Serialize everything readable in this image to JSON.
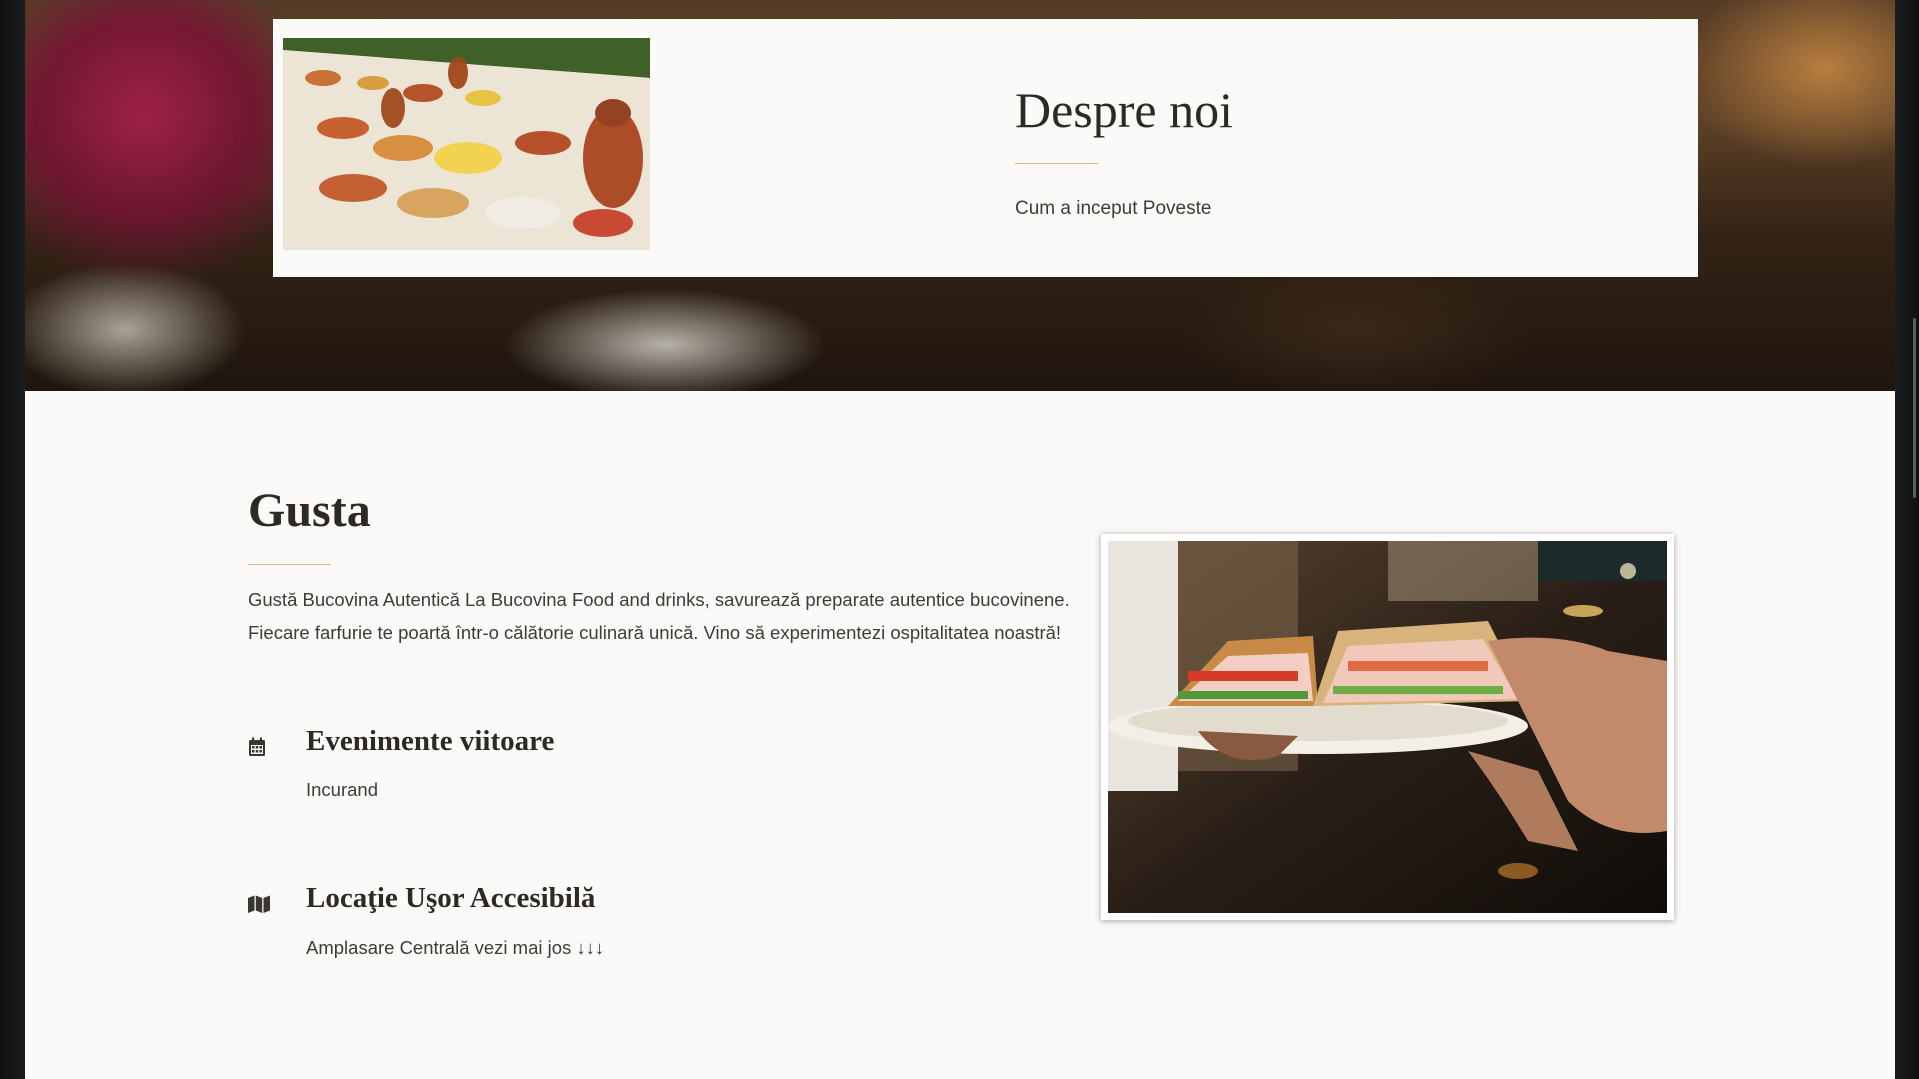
{
  "about": {
    "title": "Despre noi",
    "subtitle": "Cum a inceput Poveste",
    "photo_icon": "food-table-photo"
  },
  "gusta": {
    "title": "Gusta",
    "description": "Gustă Bucovina Autentică La Bucovina Food and drinks, savurează preparate autentice bucovinene. Fiecare farfurie te poartă într-o călătorie culinară unică. Vino să experimentezi ospitalitatea noastră!",
    "features": [
      {
        "icon": "calendar-icon",
        "title": "Evenimente viitoare",
        "description": "Incurand"
      },
      {
        "icon": "map-icon",
        "title": "Locaţie Uşor Accesibilă",
        "description": "Amplasare Centrală vezi mai jos ↓↓↓"
      }
    ],
    "photo_icon": "sandwich-plate-photo"
  },
  "colors": {
    "accent_rule": "#d6b980",
    "card_background": "#fbfaf8",
    "heading_text": "#2d2a26",
    "body_text": "#3f3b37"
  }
}
